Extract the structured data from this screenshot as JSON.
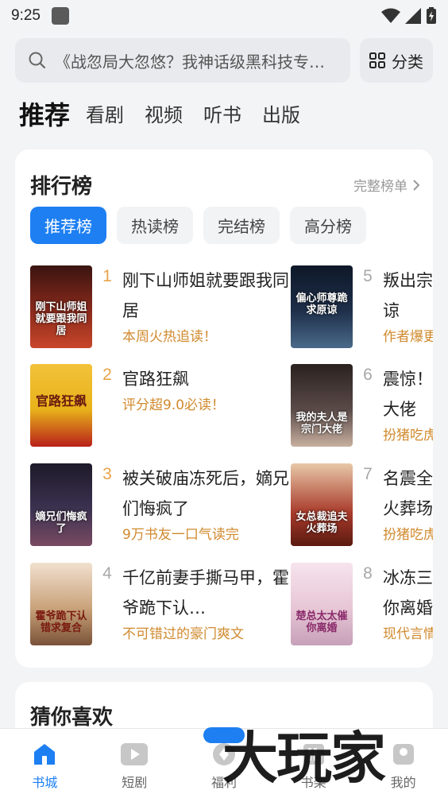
{
  "status": {
    "time": "9:25"
  },
  "search": {
    "text": "《战忽局大忽悠？我神话级黑科技专…",
    "category_label": "分类"
  },
  "top_tabs": [
    {
      "label": "推荐",
      "active": true
    },
    {
      "label": "看剧",
      "active": false
    },
    {
      "label": "视频",
      "active": false
    },
    {
      "label": "听书",
      "active": false
    },
    {
      "label": "出版",
      "active": false
    }
  ],
  "ranking": {
    "title": "排行榜",
    "more_label": "完整榜单",
    "tabs": [
      {
        "label": "推荐榜",
        "active": true
      },
      {
        "label": "热读榜",
        "active": false
      },
      {
        "label": "完结榜",
        "active": false
      },
      {
        "label": "高分榜",
        "active": false
      }
    ],
    "books": [
      {
        "rank": "1",
        "title": "刚下山师姐就要跟我同居",
        "subtitle": "本周火热追读！",
        "cover_text": "刚下山师姐就要跟我同居",
        "cover_color": "#8a2a1c"
      },
      {
        "rank": "2",
        "title": "官路狂飙",
        "subtitle": "评分超9.0必读！",
        "cover_text": "官路狂飙",
        "cover_color": "#e8b21a"
      },
      {
        "rank": "3",
        "title": "被关破庙冻死后，嫡兄们悔疯了",
        "subtitle": "9万书友一口气读完",
        "cover_text": "嫡兄们悔疯了",
        "cover_color": "#3b3250"
      },
      {
        "rank": "4",
        "title": "千亿前妻手撕马甲，霍爷跪下认…",
        "subtitle": "不可错过的豪门爽文",
        "cover_text": "霍爷跪下认错求复合",
        "cover_color": "#c9a27a"
      },
      {
        "rank": "5",
        "title": "叛出宗门，师尊跪求原谅",
        "subtitle": "作者爆更中",
        "cover_text": "偏心师尊跪求原谅",
        "cover_color": "#1e2f4a"
      },
      {
        "rank": "6",
        "title": "震惊！我的夫人是宗门大佬",
        "subtitle": "扮猪吃虎爽文",
        "cover_text": "我的夫人是宗门大佬",
        "cover_color": "#5a4a48"
      },
      {
        "rank": "7",
        "title": "名震全城，前夫裁追夫火葬场",
        "subtitle": "扮猪吃虎女强",
        "cover_text": "女总裁追夫火葬场",
        "cover_color": "#a83a2a"
      },
      {
        "rank": "8",
        "title": "冰冻三尺，楚总太太催你离婚",
        "subtitle": "现代言情",
        "cover_text": "楚总太太催你离婚",
        "cover_color": "#e7c6d6"
      }
    ]
  },
  "guess": {
    "title": "猜你喜欢"
  },
  "bottom_nav": [
    {
      "label": "书城",
      "icon": "bookstore-icon",
      "active": true
    },
    {
      "label": "短剧",
      "icon": "play-icon",
      "active": false
    },
    {
      "label": "福利",
      "icon": "welfare-icon",
      "active": false
    },
    {
      "label": "书架",
      "icon": "shelf-icon",
      "active": false
    },
    {
      "label": "我的",
      "icon": "profile-icon",
      "active": false
    }
  ],
  "watermark": "大玩家",
  "colors": {
    "accent": "#1d7ff2",
    "rank_top": "#e8a34a",
    "subtitle": "#d08a2e"
  }
}
